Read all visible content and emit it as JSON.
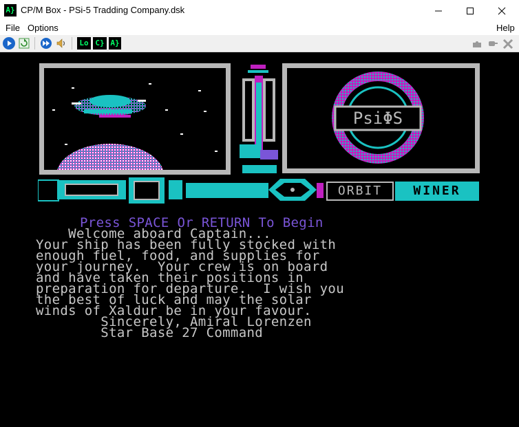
{
  "window": {
    "title": "CP/M Box - PSi-5 Tradding Company.dsk",
    "icon_text": "A}",
    "minimize_icon": "minimize-icon",
    "maximize_icon": "maximize-icon",
    "close_icon": "close-icon"
  },
  "menu": {
    "file": "File",
    "options": "Options",
    "help": "Help"
  },
  "toolbar": {
    "lo_label": "Lo",
    "c_label": "C}",
    "a_label": "A}"
  },
  "game": {
    "logo_text": "PsiΦS",
    "status_orbit": "ORBIT",
    "status_winner": "WINER",
    "prompt_text": "Press SPACE Or RETURN To Begin",
    "lines": [
      "    Welcome aboard Captain...",
      "Your ship has been fully stocked with",
      "enough fuel, food, and supplies for",
      "your journey.  Your crew is on board",
      "and have taken their positions in",
      "preparation for departure.  I wish you",
      "the best of luck and may the solar",
      "winds of Xaldur be in your favour.",
      "        Sincerely, Amiral Lorenzen",
      "        Star Base 27 Command"
    ]
  },
  "colors": {
    "cyan": "#1ac2c2",
    "magenta": "#c020c0",
    "violet": "#7a55d8",
    "grey": "#b8b8b8"
  }
}
